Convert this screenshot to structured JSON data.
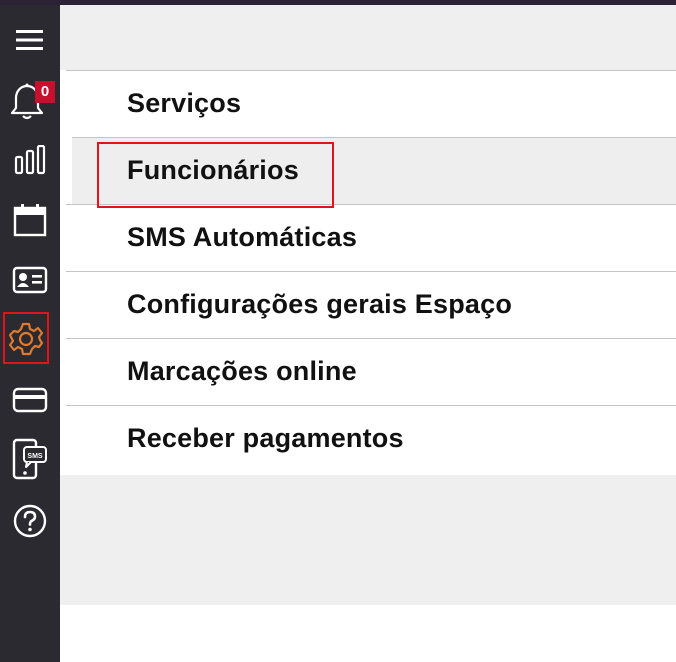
{
  "sidebar": {
    "items": [
      {
        "name": "menu-icon"
      },
      {
        "name": "notifications-bell-icon",
        "badge": "0"
      },
      {
        "name": "statistics-bars-icon"
      },
      {
        "name": "calendar-icon"
      },
      {
        "name": "client-card-icon"
      },
      {
        "name": "settings-gear-icon",
        "accent": "#e07a2c"
      },
      {
        "name": "payment-card-icon"
      },
      {
        "name": "sms-phone-icon",
        "label": "SMS"
      },
      {
        "name": "help-question-icon"
      }
    ]
  },
  "settings_menu": {
    "items": [
      {
        "label": "Serviços"
      },
      {
        "label": "Funcionários",
        "selected": true
      },
      {
        "label": "SMS Automáticas"
      },
      {
        "label": "Configurações gerais Espaço"
      },
      {
        "label": "Marcações online"
      },
      {
        "label": "Receber pagamentos"
      }
    ]
  },
  "colors": {
    "sidebar_bg": "#2a2a30",
    "highlight_border": "#e0141a",
    "badge_bg": "#c8102e",
    "settings_icon": "#e07a2c"
  }
}
